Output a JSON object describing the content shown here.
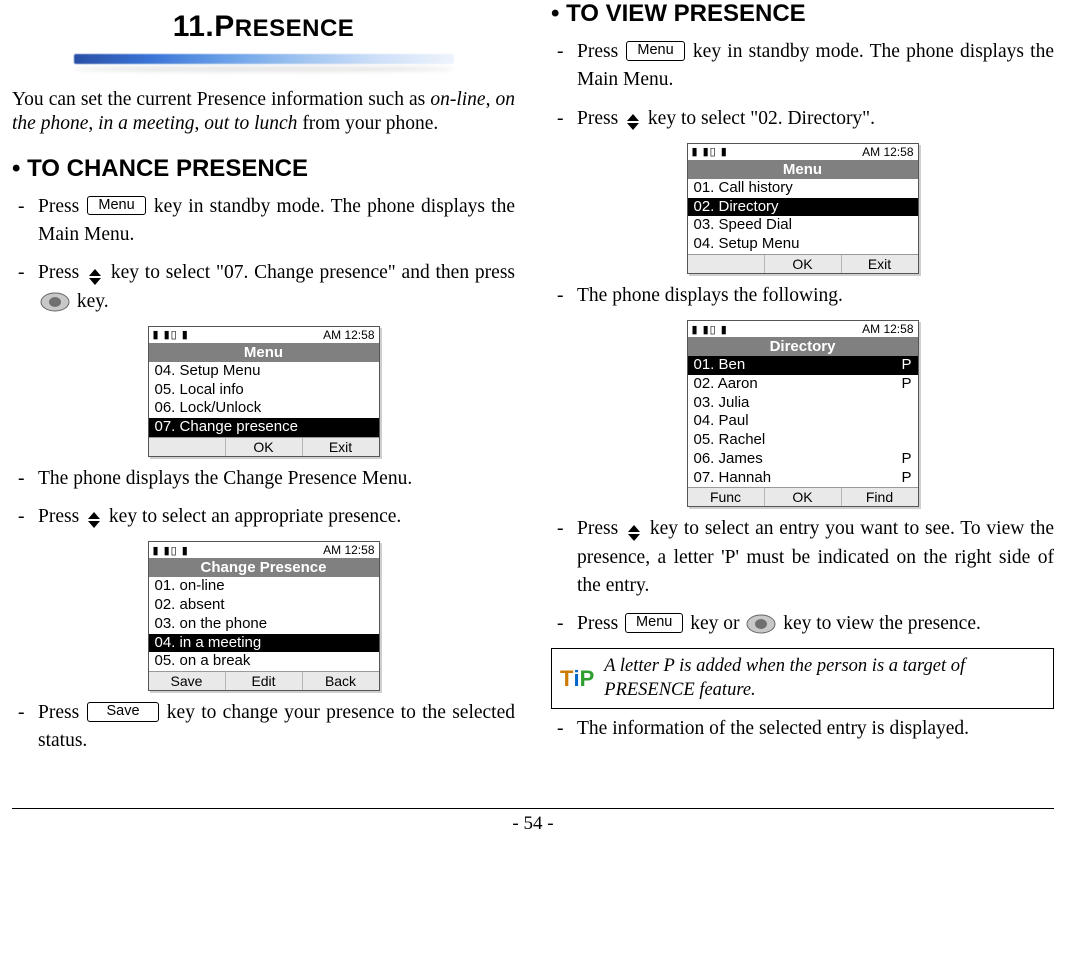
{
  "chapter": {
    "number": "11.",
    "title_first": "P",
    "title_rest": "RESENCE"
  },
  "intro": {
    "pre": "You can set the current Presence information such as ",
    "i1": "on-line",
    "c1": ", ",
    "i2": "on the phone",
    "c2": ", ",
    "i3": "in a meeting",
    "c3": ", ",
    "i4": "out to lunch",
    "post": " from your phone."
  },
  "left": {
    "heading": "• TO CHANCE PRESENCE",
    "step1_a": "Press ",
    "menu_label": "Menu",
    "step1_b": " key in standby mode. The phone displays the Main Menu.",
    "step2_a": "Press ",
    "step2_b": " key to select \"07. Change presence\" and then press ",
    "step2_c": "  key.",
    "step3": "The phone displays the Change Presence Menu.",
    "step4_a": "Press ",
    "step4_b": " key to select an appropriate presence.",
    "step5_a": "Press ",
    "save_label": "Save",
    "step5_b": "  key to change your presence to the selected status."
  },
  "right": {
    "heading": "• TO VIEW PRESENCE",
    "step1_a": "Press ",
    "menu_label": "Menu",
    "step1_b": " key in standby mode. The phone displays the Main Menu.",
    "step2_a": "Press ",
    "step2_b": " key to select \"02. Directory\".",
    "step3": "The phone displays the following.",
    "step4_a": "Press ",
    "step4_b": " key to select an entry you want to see. To view the presence, a letter 'P' must be indicated on the right side of the entry.",
    "step5_a": "Press ",
    "step5_b": "  key or ",
    "step5_c": "  key to view the presence.",
    "tip": "A letter P is added when the person is a target of PRESENCE feature.",
    "step6": "The information of the selected entry is displayed."
  },
  "phone_common": {
    "time": "AM 12:58",
    "icons": "▮ ▮▯ ▮"
  },
  "phone1": {
    "title": "Menu",
    "rows": [
      {
        "t": "04. Setup Menu",
        "sel": false
      },
      {
        "t": "05. Local info",
        "sel": false
      },
      {
        "t": "06. Lock/Unlock",
        "sel": false
      },
      {
        "t": "07. Change presence",
        "sel": true
      }
    ],
    "sk": [
      "",
      "OK",
      "Exit"
    ]
  },
  "phone2": {
    "title": "Change Presence",
    "rows": [
      {
        "t": "01. on-line",
        "sel": false
      },
      {
        "t": "02. absent",
        "sel": false
      },
      {
        "t": "03. on the phone",
        "sel": false
      },
      {
        "t": "04. in a meeting",
        "sel": true
      },
      {
        "t": "05. on a break",
        "sel": false
      }
    ],
    "sk": [
      "Save",
      "Edit",
      "Back"
    ]
  },
  "phone3": {
    "title": "Menu",
    "rows": [
      {
        "t": "01. Call history",
        "sel": false
      },
      {
        "t": "02. Directory",
        "sel": true
      },
      {
        "t": "03. Speed Dial",
        "sel": false
      },
      {
        "t": "04. Setup Menu",
        "sel": false
      }
    ],
    "sk": [
      "",
      "OK",
      "Exit"
    ]
  },
  "phone4": {
    "title": "Directory",
    "rows": [
      {
        "t": "01. Ben",
        "p": "P",
        "sel": true
      },
      {
        "t": "02. Aaron",
        "p": "P",
        "sel": false
      },
      {
        "t": "03. Julia",
        "p": "",
        "sel": false
      },
      {
        "t": "04. Paul",
        "p": "",
        "sel": false
      },
      {
        "t": "05. Rachel",
        "p": "",
        "sel": false
      },
      {
        "t": "06. James",
        "p": "P",
        "sel": false
      },
      {
        "t": "07. Hannah",
        "p": "P",
        "sel": false
      }
    ],
    "sk": [
      "Func",
      "OK",
      "Find"
    ]
  },
  "footer": "- 54 -"
}
